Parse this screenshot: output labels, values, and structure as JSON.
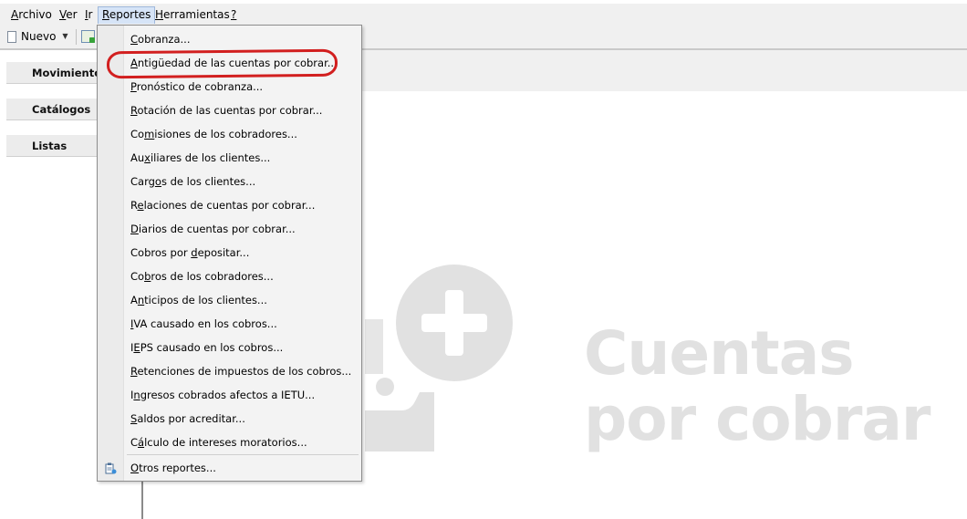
{
  "menubar": {
    "items": [
      {
        "label": "Archivo",
        "hotkey": "A",
        "rest": "rchivo"
      },
      {
        "label": "Ver",
        "hotkey": "V",
        "rest": "er"
      },
      {
        "label": "Ir",
        "hotkey": "I",
        "rest": "r"
      },
      {
        "label": "Reportes",
        "hotkey": "R",
        "rest": "eportes"
      },
      {
        "label": "Herramientas",
        "hotkey": "H",
        "rest": "erramientas"
      },
      {
        "label": "?",
        "hotkey": "?",
        "rest": ""
      }
    ],
    "active": "Reportes"
  },
  "toolbar": {
    "new_label": "Nuevo",
    "icons": [
      "new-document-icon",
      "dropdown-caret-icon",
      "add-record-icon"
    ]
  },
  "nav": {
    "movimientos": "Movimientos",
    "catalogos": "Catálogos",
    "listas": "Listas"
  },
  "reportes_menu": {
    "items": [
      {
        "pre": "",
        "u": "C",
        "post": "obranza..."
      },
      {
        "pre": "",
        "u": "A",
        "post": "ntigüedad de las cuentas por cobrar..."
      },
      {
        "pre": "",
        "u": "P",
        "post": "ronóstico de cobranza..."
      },
      {
        "pre": "",
        "u": "R",
        "post": "otación de las cuentas por cobrar..."
      },
      {
        "pre": "Co",
        "u": "m",
        "post": "isiones de los cobradores..."
      },
      {
        "pre": "Au",
        "u": "x",
        "post": "iliares de los clientes..."
      },
      {
        "pre": "Carg",
        "u": "o",
        "post": "s de los clientes..."
      },
      {
        "pre": "R",
        "u": "e",
        "post": "laciones de cuentas por cobrar..."
      },
      {
        "pre": "",
        "u": "D",
        "post": "iarios de cuentas por cobrar..."
      },
      {
        "pre": "Cobros por ",
        "u": "d",
        "post": "epositar..."
      },
      {
        "pre": "Co",
        "u": "b",
        "post": "ros de los cobradores..."
      },
      {
        "pre": "A",
        "u": "n",
        "post": "ticipos de los clientes..."
      },
      {
        "pre": "",
        "u": "I",
        "post": "VA causado en los cobros..."
      },
      {
        "pre": "I",
        "u": "E",
        "post": "PS causado en los cobros..."
      },
      {
        "pre": "",
        "u": "R",
        "post": "etenciones de impuestos de los cobros..."
      },
      {
        "pre": "I",
        "u": "n",
        "post": "gresos cobrados afectos a IETU..."
      },
      {
        "pre": "",
        "u": "S",
        "post": "aldos por acreditar..."
      },
      {
        "pre": "C",
        "u": "á",
        "post": "lculo de intereses moratorios..."
      }
    ],
    "footer": {
      "pre": "",
      "u": "O",
      "post": "tros reportes...",
      "icon": "reports-icon"
    },
    "highlighted_item": "Antigüedad de las cuentas por cobrar...",
    "highlight_color": "#d21f1f"
  },
  "watermark": {
    "line1": "Cuentas",
    "line2": "por cobrar",
    "color": "#e1e1e1",
    "icon": "plus-logo-icon"
  },
  "colors": {
    "menu_active_bg": "#d6e4f7",
    "menu_bg": "#f3f3f3",
    "bar_bg": "#f0f0f0"
  }
}
